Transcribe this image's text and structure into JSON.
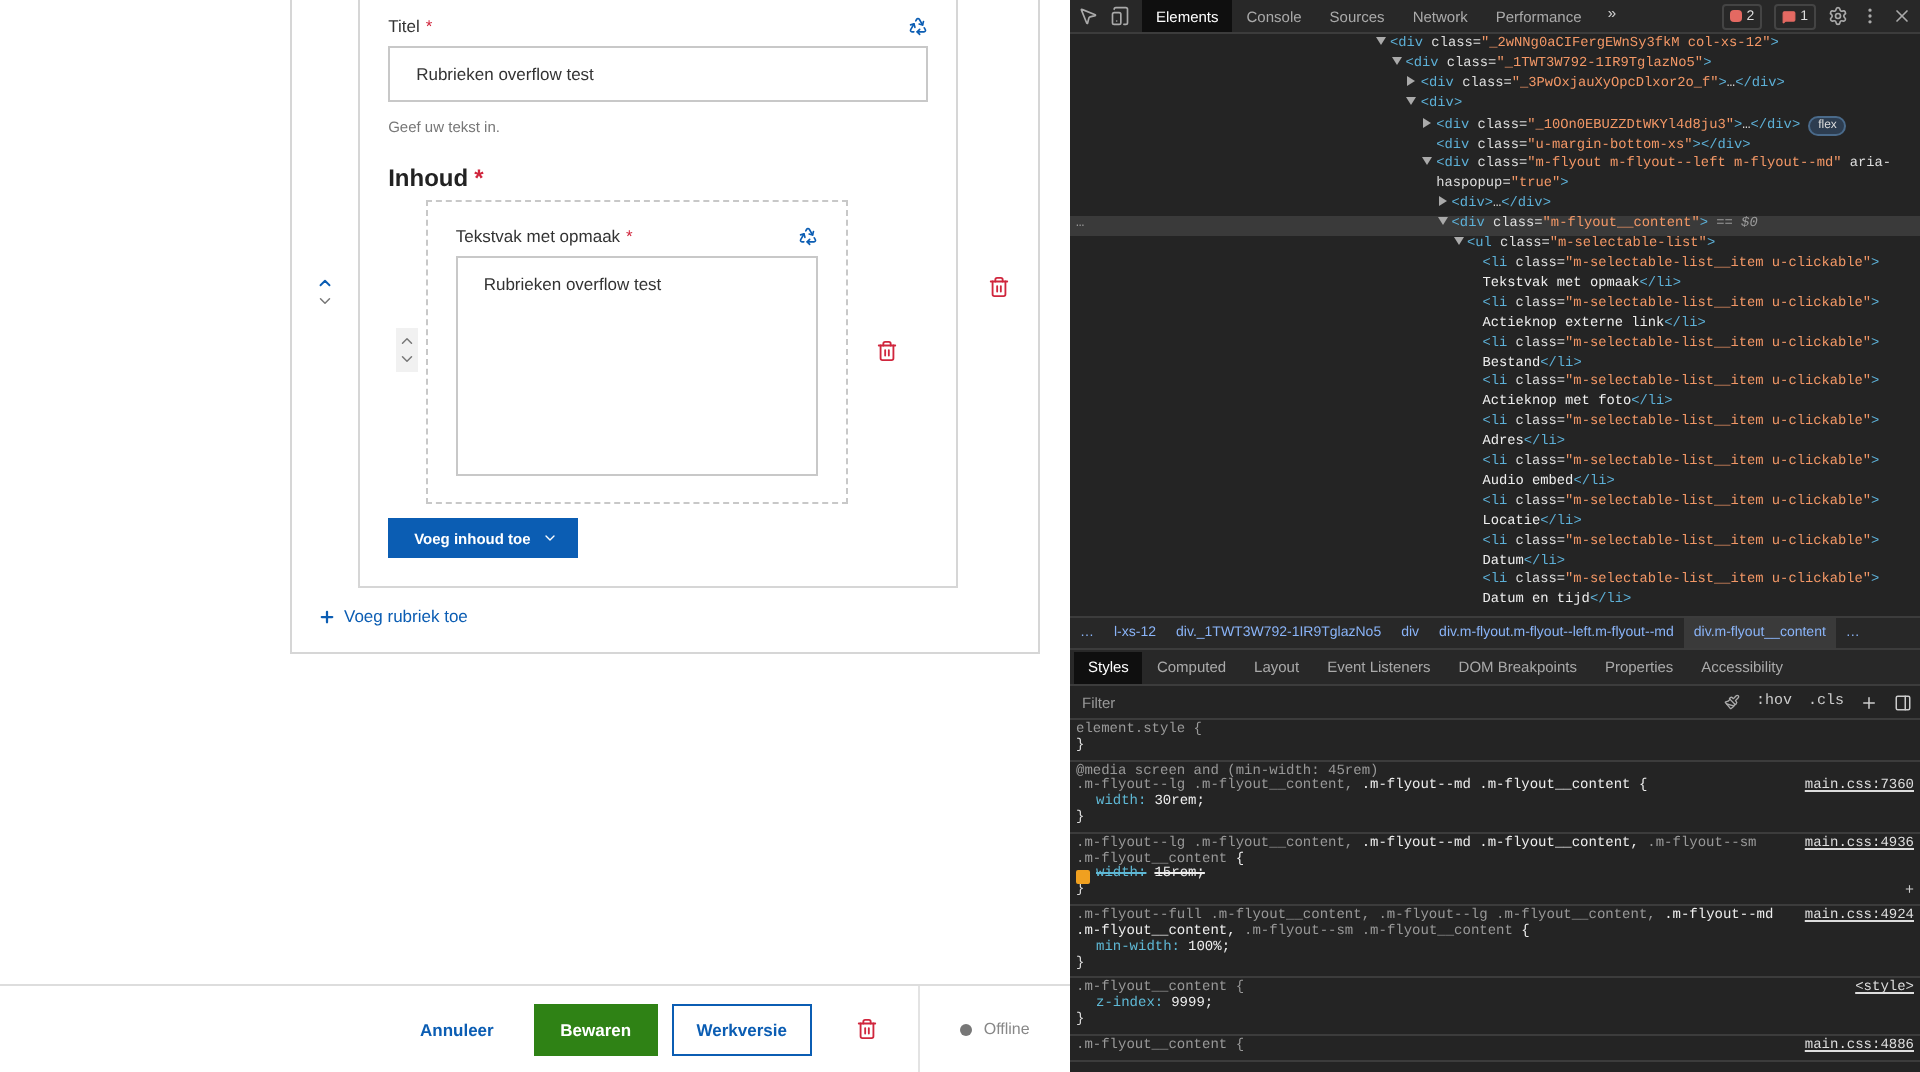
{
  "form": {
    "title_label": "Titel",
    "title_required": "*",
    "title_value": "Rubrieken overflow test",
    "title_hint": "Geef uw tekst in.",
    "content_heading": "Inhoud",
    "content_required": "*",
    "block": {
      "label": "Tekstvak met opmaak",
      "required": "*",
      "value": "Rubrieken overflow test"
    },
    "add_content_button": "Voeg inhoud toe",
    "add_section_link": "Voeg rubriek toe"
  },
  "footer": {
    "cancel": "Annuleer",
    "save": "Bewaren",
    "draft": "Werkversie",
    "status": "Offline"
  },
  "devtools": {
    "tabs": [
      {
        "label": "Elements",
        "selected": true
      },
      {
        "label": "Console",
        "selected": false
      },
      {
        "label": "Sources",
        "selected": false
      },
      {
        "label": "Network",
        "selected": false
      },
      {
        "label": "Performance",
        "selected": false
      }
    ],
    "more_tabs": "»",
    "errors": "2",
    "warnings": "1",
    "dom": [
      {
        "markup": "<div class=\"_2wNNg0aCIFergEWnSy3fkM col-xs-12\">",
        "expanded": true,
        "selected": false,
        "children": [
          {
            "markup": "<div class=\"_1TWT3W792-1IR9TglazNo5\">",
            "expanded": true,
            "selected": false,
            "children": [
              {
                "markup": "<div class=\"_3PwOxjauXyOpcDlxor2o_f\">…</div>",
                "expanded": false,
                "selected": false
              },
              {
                "markup": "<div>",
                "expanded": true,
                "selected": false,
                "children": [
                  {
                    "markup": "<div class=\"_10On0EBUZZDtWKYl4d8ju3\">…</div>",
                    "expanded": false,
                    "selected": false,
                    "badge": "flex"
                  },
                  {
                    "markup": "<div class=\"u-margin-bottom-xs\"></div>",
                    "selected": false
                  },
                  {
                    "markup": "<div class=\"m-flyout m-flyout--left m-flyout--md\" aria-haspopup=\"true\">",
                    "expanded": true,
                    "selected": false,
                    "children": [
                      {
                        "markup": "<div>…</div>",
                        "expanded": false,
                        "selected": false
                      },
                      {
                        "markup": "<div class=\"m-flyout__content\">",
                        "expanded": true,
                        "selected": true,
                        "gutter": "…",
                        "suffix": "== $0",
                        "children": [
                          {
                            "markup": "<ul class=\"m-selectable-list\">",
                            "expanded": true,
                            "selected": false,
                            "children": [
                              {
                                "markup": "<li class=\"m-selectable-list__item u-clickable\">",
                                "text": "Tekstvak met opmaak",
                                "close": "</li>",
                                "selected": false
                              },
                              {
                                "markup": "<li class=\"m-selectable-list__item u-clickable\">",
                                "text": "Actieknop externe link",
                                "close": "</li>",
                                "selected": false
                              },
                              {
                                "markup": "<li class=\"m-selectable-list__item u-clickable\">",
                                "text": "Bestand",
                                "close": "</li>",
                                "selected": false
                              },
                              {
                                "markup": "<li class=\"m-selectable-list__item u-clickable\">",
                                "text": "Actieknop met foto",
                                "close": "</li>",
                                "selected": false
                              },
                              {
                                "markup": "<li class=\"m-selectable-list__item u-clickable\">",
                                "text": "Adres",
                                "close": "</li>",
                                "selected": false
                              },
                              {
                                "markup": "<li class=\"m-selectable-list__item u-clickable\">",
                                "text": "Audio embed",
                                "close": "</li>",
                                "selected": false
                              },
                              {
                                "markup": "<li class=\"m-selectable-list__item u-clickable\">",
                                "text": "Locatie",
                                "close": "</li>",
                                "selected": false
                              },
                              {
                                "markup": "<li class=\"m-selectable-list__item u-clickable\">",
                                "text": "Datum",
                                "close": "</li>",
                                "selected": false
                              },
                              {
                                "markup": "<li class=\"m-selectable-list__item u-clickable\">",
                                "text": "Datum en tijd",
                                "close": "</li>",
                                "selected": false
                              }
                            ]
                          }
                        ]
                      }
                    ]
                  }
                ]
              }
            ]
          }
        ]
      }
    ],
    "breadcrumbs": [
      {
        "label": "…",
        "selected": false
      },
      {
        "label": "l-xs-12",
        "selected": false
      },
      {
        "label": "div._1TWT3W792-1IR9TglazNo5",
        "selected": false
      },
      {
        "label": "div",
        "selected": false
      },
      {
        "label": "div.m-flyout.m-flyout--left.m-flyout--md",
        "selected": false
      },
      {
        "label": "div.m-flyout__content",
        "selected": true
      },
      {
        "label": "…",
        "selected": false
      }
    ],
    "style_tabs": [
      {
        "label": "Styles",
        "selected": true
      },
      {
        "label": "Computed",
        "selected": false
      },
      {
        "label": "Layout",
        "selected": false
      },
      {
        "label": "Event Listeners",
        "selected": false
      },
      {
        "label": "DOM Breakpoints",
        "selected": false
      },
      {
        "label": "Properties",
        "selected": false
      },
      {
        "label": "Accessibility",
        "selected": false
      }
    ],
    "filter": {
      "placeholder": "Filter",
      "buttons": [
        ":hov",
        ".cls"
      ]
    },
    "rules": [
      {
        "selector": "element.style {",
        "close": "}"
      },
      {
        "media": "@media screen and (min-width: 45rem)",
        "selector": ".m-flyout--lg .m-flyout__content, **.m-flyout--md .m-flyout__content {**",
        "source": "main.css:7360",
        "props": [
          {
            "name": "width:",
            "value": "30rem;",
            "struck": false
          }
        ],
        "close": "}"
      },
      {
        "selector": ".m-flyout--lg .m-flyout__content, **.m-flyout--md .m-flyout__content,** .m-flyout--sm .m-flyout__content **{**",
        "source": "main.css:4936",
        "props": [
          {
            "name": "width:",
            "value": "15rem;",
            "struck": true,
            "checked": true
          }
        ],
        "close": "}",
        "add": "+"
      },
      {
        "selector": ".m-flyout--full .m-flyout__content, .m-flyout--lg .m-flyout__content, **.m-flyout--md .m-flyout__content,** .m-flyout--sm .m-flyout__content **{**",
        "source": "main.css:4924",
        "props": [
          {
            "name": "min-width:",
            "value": "100%;",
            "struck": false
          }
        ],
        "close": "}"
      },
      {
        "selector": ".m-flyout__content {",
        "source": "<style>",
        "props": [
          {
            "name": "z-index:",
            "value": "9999;",
            "struck": false
          }
        ],
        "close": "}"
      },
      {
        "selector": ".m-flyout__content {",
        "source": "main.css:4886"
      }
    ]
  }
}
